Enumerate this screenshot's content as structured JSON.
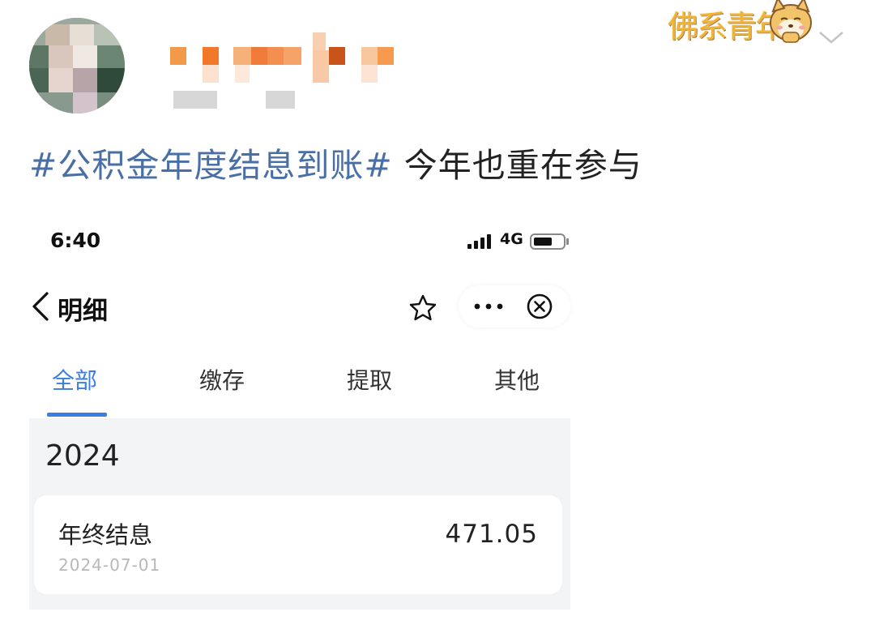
{
  "post": {
    "hashtag": "#公积金年度结息到账#",
    "text": " 今年也重在参与",
    "badge_text": "佛系青年"
  },
  "status_bar": {
    "time": "6:40",
    "network": "4G"
  },
  "nav": {
    "title": "明细"
  },
  "tabs": [
    "全部",
    "缴存",
    "提取",
    "其他"
  ],
  "active_tab": "全部",
  "colors": {
    "accent": "#3b7de0",
    "hashtag": "#496fa6",
    "list_background": "#f3f4f6"
  },
  "records": {
    "year": "2024",
    "items": [
      {
        "title": "年终结息",
        "date": "2024-07-01",
        "amount": "471.05"
      }
    ]
  }
}
